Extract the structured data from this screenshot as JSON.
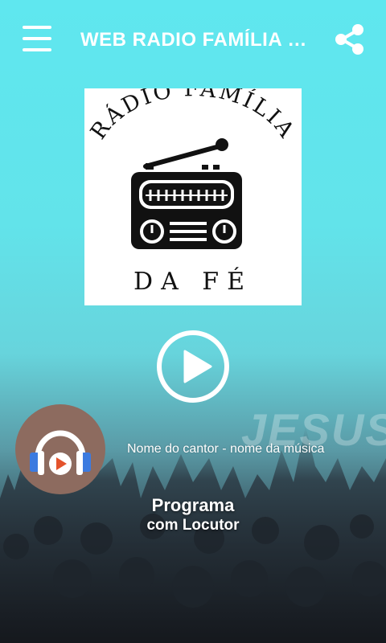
{
  "appbar": {
    "title": "WEB RADIO FAMÍLIA …",
    "menu_icon": "hamburger-menu-icon",
    "share_icon": "share-icon"
  },
  "logo": {
    "top_text": "RÁDIO FAMÍLIA",
    "bottom_text": "DA FÉ",
    "icon": "radio-icon"
  },
  "player": {
    "play_icon": "play-icon",
    "song_info": "Nome do cantor - nome da música",
    "cover_icon": "headphones-play-icon"
  },
  "program": {
    "title": "Programa",
    "host": "com Locutor"
  },
  "background": {
    "watermark": "JESUS"
  },
  "colors": {
    "sky_top": "#5fe7ef",
    "cover_bg": "#8d6b5f",
    "headphone_blue": "#3c7be0",
    "play_red": "#e4532c"
  }
}
